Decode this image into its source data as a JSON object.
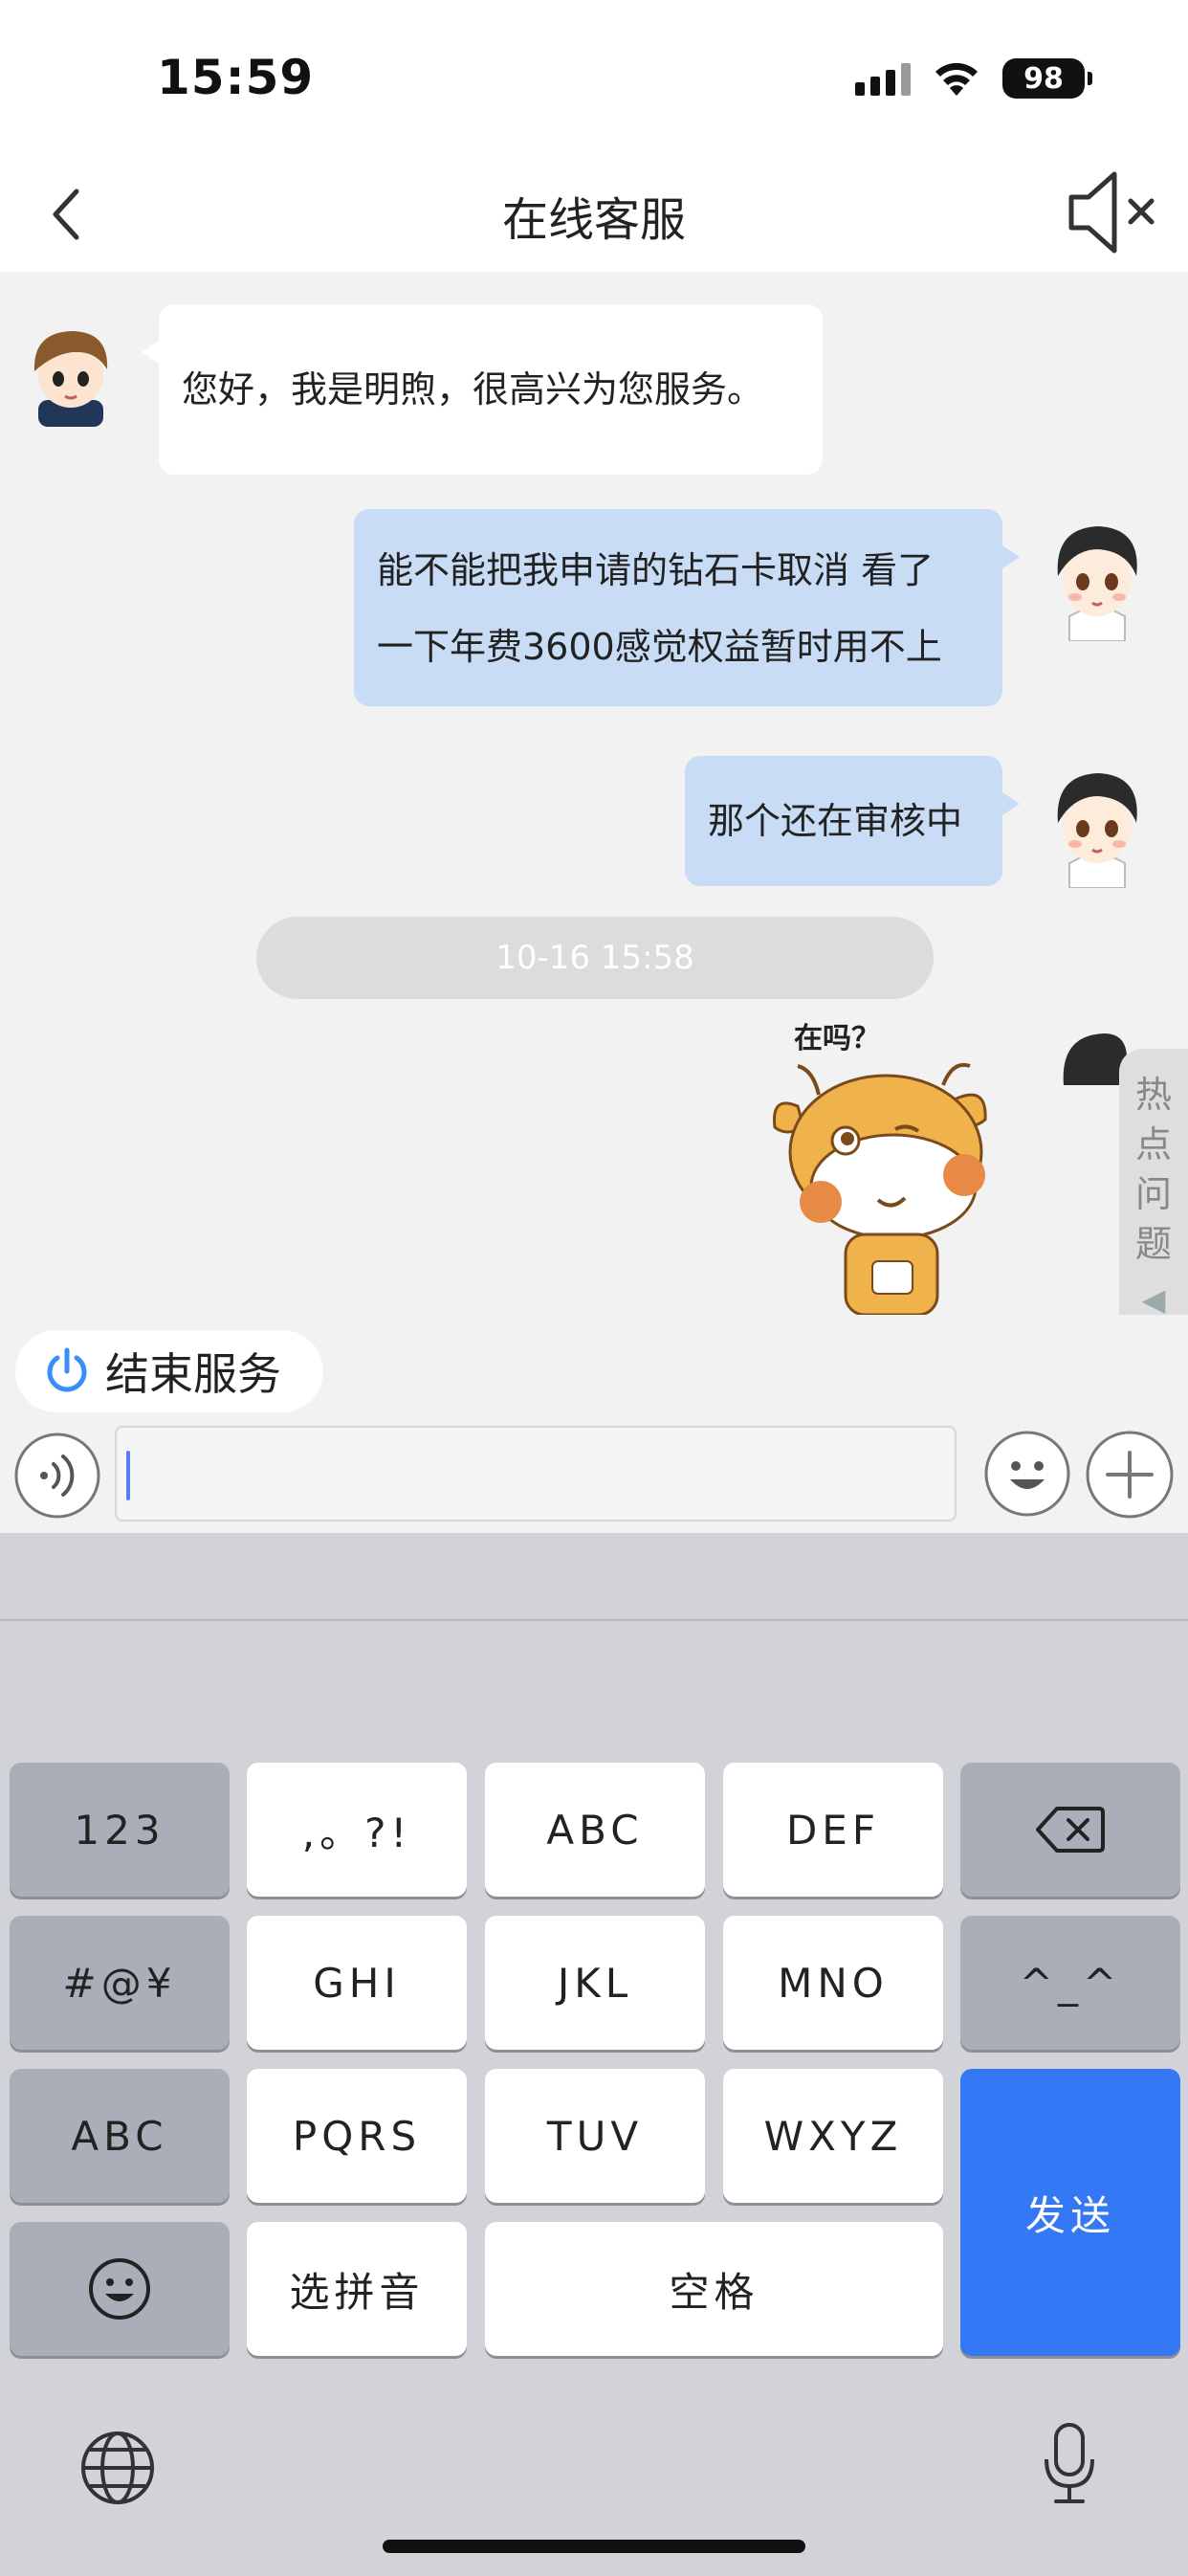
{
  "status_bar": {
    "time": "15:59",
    "battery": "98"
  },
  "header": {
    "title": "在线客服"
  },
  "chat": {
    "messages": [
      {
        "side": "left",
        "text": "您好，我是明煦，很高兴为您服务。"
      },
      {
        "side": "right",
        "lines": [
          "能不能把我申请的钻石卡取消 看了",
          "一下年费3600感觉权益暂时用不上"
        ]
      },
      {
        "side": "right",
        "text": "那个还在审核中"
      }
    ],
    "timestamp": "10-16 15:58",
    "sticker_text": "在吗？",
    "hot_tab": [
      "热",
      "点",
      "问",
      "题"
    ]
  },
  "actions": {
    "end_service": "结束服务"
  },
  "keyboard": {
    "rows": [
      [
        "123",
        ",。?!",
        "ABC",
        "DEF"
      ],
      [
        "#@¥",
        "GHI",
        "JKL",
        "MNO",
        "^_^"
      ],
      [
        "ABC",
        "PQRS",
        "TUV",
        "WXYZ"
      ],
      [
        "选拼音",
        "空格"
      ]
    ],
    "send": "发送"
  },
  "colors": {
    "accent": "#3478f6",
    "bubble_right": "#c8ddf5",
    "power_icon": "#3b8ef3"
  }
}
